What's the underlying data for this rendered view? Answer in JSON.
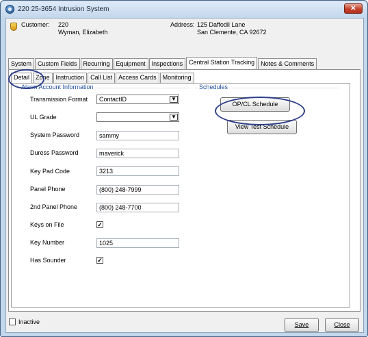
{
  "window": {
    "title": "220 25-3654 Intrusion System",
    "close_label": "✕"
  },
  "customer": {
    "label": "Customer:",
    "id": "220",
    "name": "Wyman, Elizabeth",
    "address_label": "Address:",
    "address_line1": "125 Daffodil Lane",
    "address_line2": "San Clemente, CA  92672"
  },
  "tabs": [
    {
      "label": "System"
    },
    {
      "label": "Custom Fields"
    },
    {
      "label": "Recurring"
    },
    {
      "label": "Equipment"
    },
    {
      "label": "Inspections"
    },
    {
      "label": "Central Station Tracking"
    },
    {
      "label": "Notes & Comments"
    }
  ],
  "sub_tabs": [
    {
      "label": "Detail"
    },
    {
      "label": "Zone"
    },
    {
      "label": "Instruction"
    },
    {
      "label": "Call List"
    },
    {
      "label": "Access Cards"
    },
    {
      "label": "Monitoring"
    }
  ],
  "alarm_account": {
    "group_title": "Alarm Account Information",
    "fields": {
      "transmission_format": {
        "label": "Transmission Format",
        "value": "ContactID"
      },
      "ul_grade": {
        "label": "UL Grade",
        "value": ""
      },
      "system_password": {
        "label": "System Password",
        "value": "sammy"
      },
      "duress_password": {
        "label": "Duress Password",
        "value": "maverick"
      },
      "key_pad_code": {
        "label": "Key Pad Code",
        "value": "3213"
      },
      "panel_phone": {
        "label": "Panel Phone",
        "value": "(800) 248-7999"
      },
      "second_panel_phone": {
        "label": "2nd Panel Phone",
        "value": "(800) 248-7700"
      },
      "keys_on_file": {
        "label": "Keys on File",
        "checked": "✓"
      },
      "key_number": {
        "label": "Key Number",
        "value": "1025"
      },
      "has_sounder": {
        "label": "Has Sounder",
        "checked": "✓"
      }
    }
  },
  "schedules": {
    "group_title": "Schedules",
    "opcl_button": "OP/CL Schedule",
    "view_test_button": "View Test Schedule"
  },
  "footer": {
    "inactive_label": "Inactive",
    "save_label": "Save",
    "close_label": "Close"
  },
  "colors": {
    "window_frame": "#c3d7ed",
    "group_title": "#1f4e9c",
    "highlight": "#2e3f8a"
  }
}
